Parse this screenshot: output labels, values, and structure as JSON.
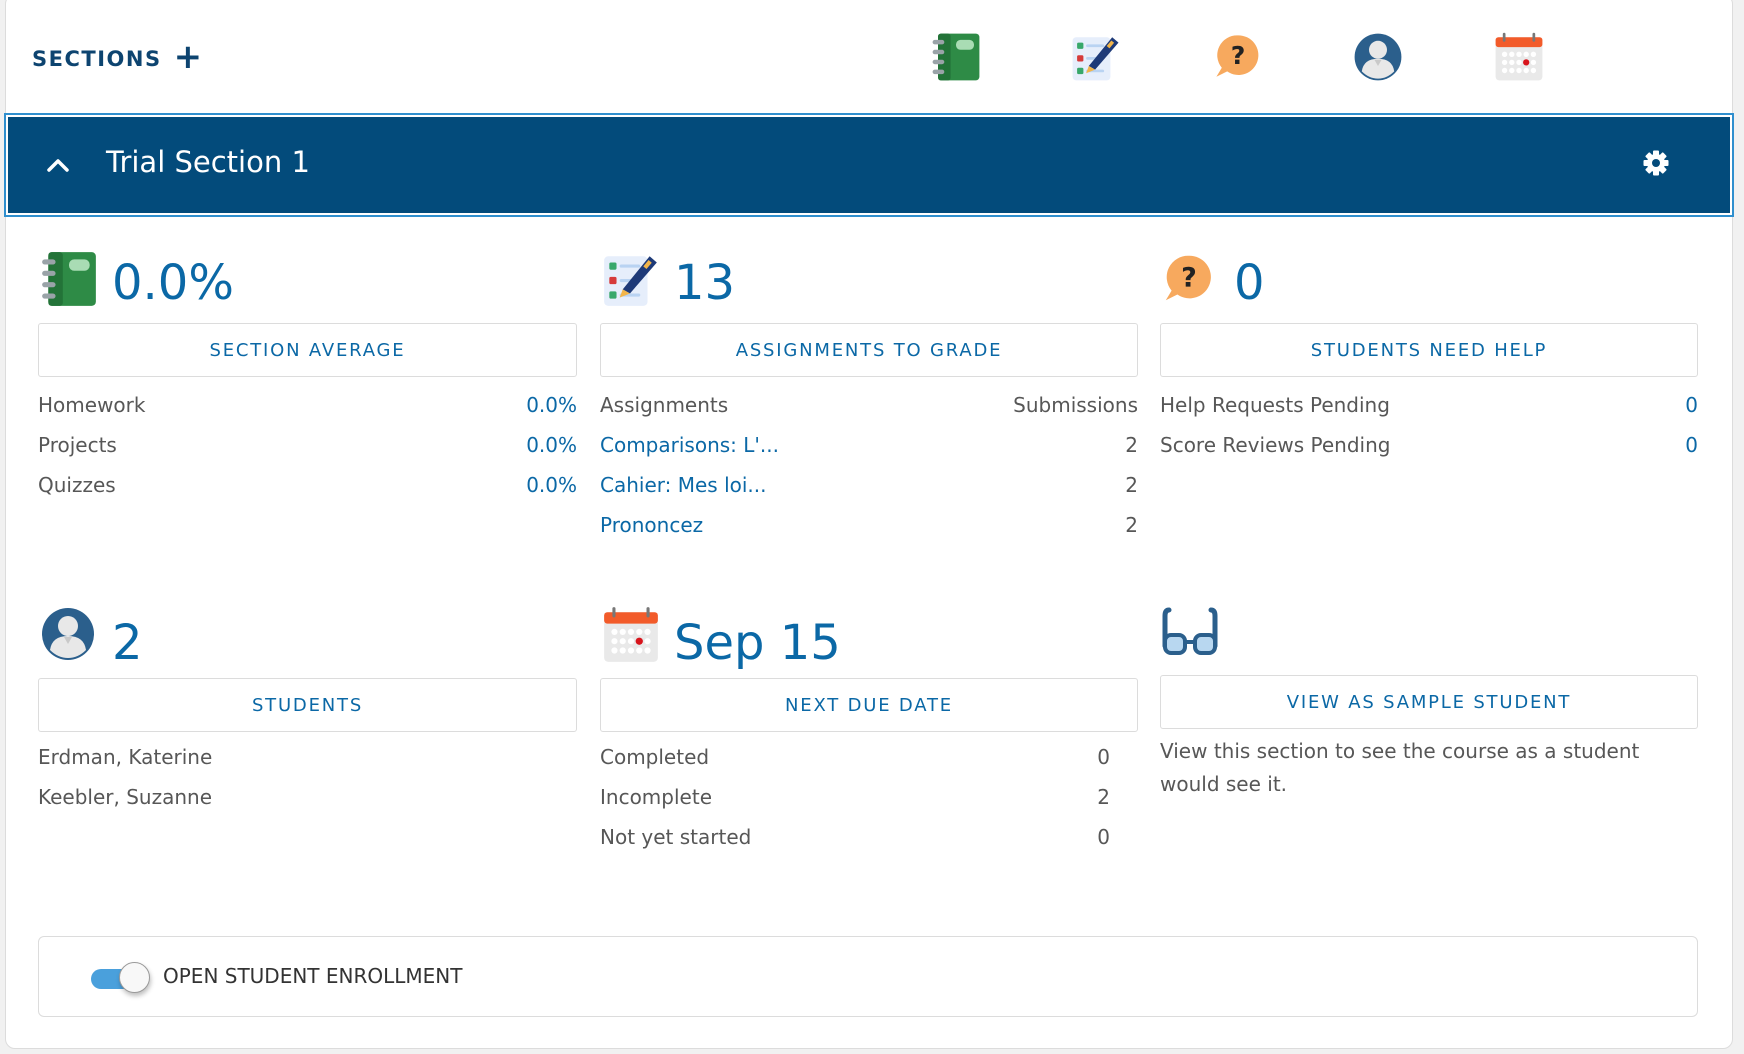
{
  "header": {
    "sections_label": "SECTIONS",
    "add_icon": "plus-icon",
    "nav_icons": [
      {
        "name": "gradebook-icon"
      },
      {
        "name": "grading-icon"
      },
      {
        "name": "help-icon"
      },
      {
        "name": "students-icon"
      },
      {
        "name": "calendar-icon"
      }
    ]
  },
  "section": {
    "name": "Trial Section 1",
    "collapse_icon": "chevron-up-icon",
    "settings_icon": "gear-icon",
    "colors": {
      "bar": "#034b7b",
      "focus_ring": "#2f8fce",
      "accent": "#0b68a6"
    }
  },
  "cards": {
    "average": {
      "value": "0.0%",
      "label": "SECTION AVERAGE",
      "rows": [
        {
          "name": "Homework",
          "value": "0.0%"
        },
        {
          "name": "Projects",
          "value": "0.0%"
        },
        {
          "name": "Quizzes",
          "value": "0.0%"
        }
      ]
    },
    "assignments": {
      "value": "13",
      "label": "ASSIGNMENTS TO GRADE",
      "col_headers": {
        "left": "Assignments",
        "right": "Submissions"
      },
      "rows": [
        {
          "name": "Comparisons: L'...",
          "value": "2"
        },
        {
          "name": "Cahier: Mes loi...",
          "value": "2"
        },
        {
          "name": "Prononcez",
          "value": "2"
        }
      ]
    },
    "help": {
      "value": "0",
      "label": "STUDENTS NEED HELP",
      "rows": [
        {
          "name": "Help Requests Pending",
          "value": "0"
        },
        {
          "name": "Score Reviews Pending",
          "value": "0"
        }
      ]
    },
    "students": {
      "value": "2",
      "label": "STUDENTS",
      "list": [
        "Erdman, Katerine",
        "Keebler, Suzanne"
      ]
    },
    "due": {
      "value": "Sep 15",
      "label": "NEXT DUE DATE",
      "rows": [
        {
          "name": "Completed",
          "value": "0"
        },
        {
          "name": "Incomplete",
          "value": "2"
        },
        {
          "name": "Not yet started",
          "value": "0"
        }
      ]
    },
    "sample": {
      "label": "VIEW AS SAMPLE STUDENT",
      "description": "View this section to see the course as a student would see it."
    }
  },
  "enrollment": {
    "label": "OPEN STUDENT ENROLLMENT",
    "enabled": true
  }
}
